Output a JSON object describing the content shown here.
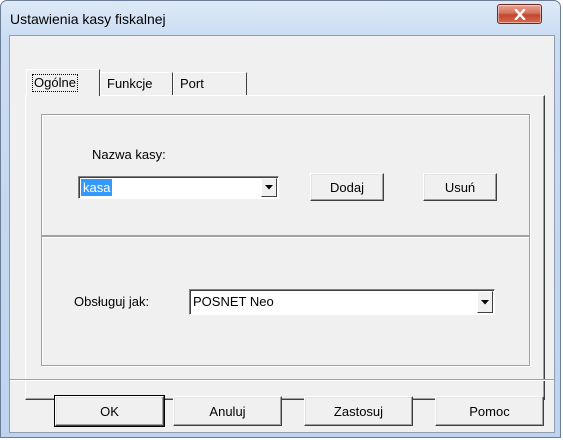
{
  "window": {
    "title": "Ustawienia kasy fiskalnej"
  },
  "tabs": [
    {
      "label": "Ogólne",
      "active": true
    },
    {
      "label": "Funkcje",
      "active": false
    },
    {
      "label": "Port",
      "active": false
    }
  ],
  "register": {
    "label": "Nazwa kasy:",
    "value": "kasa",
    "add_label": "Dodaj",
    "remove_label": "Usuń"
  },
  "handle": {
    "label": "Obsługuj jak:",
    "value": "POSNET Neo"
  },
  "footer": {
    "ok_label": "OK",
    "cancel_label": "Anuluj",
    "apply_label": "Zastosuj",
    "help_label": "Pomoc"
  },
  "icons": {
    "close": "close-icon",
    "dropdown": "chevron-down-icon"
  },
  "colors": {
    "selection": "#3399ff",
    "close_button": "#c2472e"
  }
}
